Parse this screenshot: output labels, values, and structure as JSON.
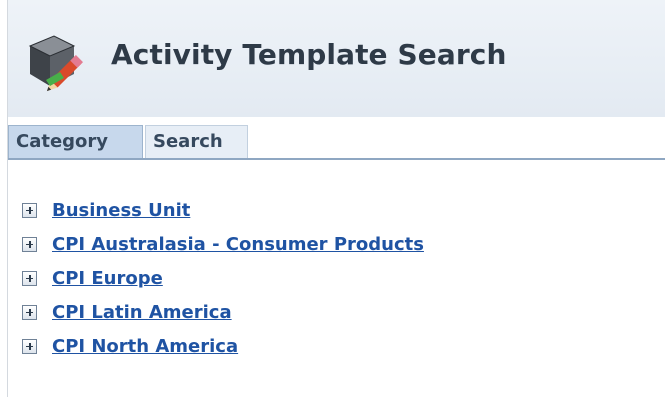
{
  "header": {
    "title": "Activity Template Search",
    "icon": "cube-pencil-icon"
  },
  "tabs": [
    {
      "label": "Category",
      "selected": true
    },
    {
      "label": "Search",
      "selected": false
    }
  ],
  "tree": {
    "items": [
      {
        "label": "Business Unit",
        "icon": "expand-plus-icon"
      },
      {
        "label": "CPI Australasia - Consumer Products",
        "icon": "expand-plus-icon"
      },
      {
        "label": "CPI Europe",
        "icon": "expand-plus-icon"
      },
      {
        "label": "CPI Latin America",
        "icon": "expand-plus-icon"
      },
      {
        "label": "CPI North America",
        "icon": "expand-plus-icon"
      }
    ]
  },
  "colors": {
    "header_bg": "#e3eaf2",
    "tab_active_bg": "#c7d8ec",
    "link": "#1f53a3",
    "title_text": "#2e3a47"
  }
}
